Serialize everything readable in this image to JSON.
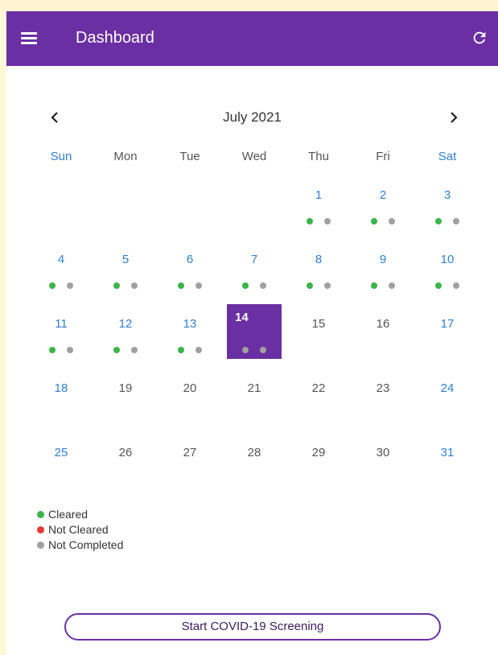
{
  "header": {
    "title": "Dashboard",
    "menu_icon": "menu-icon",
    "refresh_icon": "refresh-icon",
    "color": "#6a2fa3"
  },
  "calendar": {
    "month_label": "July 2021",
    "prev_icon": "chevron-left-icon",
    "next_icon": "chevron-right-icon",
    "weekdays": [
      "Sun",
      "Mon",
      "Tue",
      "Wed",
      "Thu",
      "Fri",
      "Sat"
    ],
    "selected_day": "14",
    "days": [
      {
        "label": "1",
        "blue": true,
        "dots": [
          "green",
          "gray"
        ]
      },
      {
        "label": "2",
        "blue": true,
        "dots": [
          "green",
          "gray"
        ]
      },
      {
        "label": "3",
        "blue": true,
        "dots": [
          "green",
          "gray"
        ]
      },
      {
        "label": "4",
        "blue": true,
        "dots": [
          "green",
          "gray"
        ]
      },
      {
        "label": "5",
        "blue": true,
        "dots": [
          "green",
          "gray"
        ]
      },
      {
        "label": "6",
        "blue": true,
        "dots": [
          "green",
          "gray"
        ]
      },
      {
        "label": "7",
        "blue": true,
        "dots": [
          "green",
          "gray"
        ]
      },
      {
        "label": "8",
        "blue": true,
        "dots": [
          "green",
          "gray"
        ]
      },
      {
        "label": "9",
        "blue": true,
        "dots": [
          "green",
          "gray"
        ]
      },
      {
        "label": "10",
        "blue": true,
        "dots": [
          "green",
          "gray"
        ]
      },
      {
        "label": "11",
        "blue": true,
        "dots": [
          "green",
          "gray"
        ]
      },
      {
        "label": "12",
        "blue": true,
        "dots": [
          "green",
          "gray"
        ]
      },
      {
        "label": "13",
        "blue": true,
        "dots": [
          "green",
          "gray"
        ]
      },
      {
        "label": "14",
        "blue": false,
        "dots": [
          "gray",
          "gray"
        ]
      },
      {
        "label": "15",
        "blue": false,
        "dots": []
      },
      {
        "label": "16",
        "blue": false,
        "dots": []
      },
      {
        "label": "17",
        "blue": true,
        "dots": []
      },
      {
        "label": "18",
        "blue": true,
        "dots": []
      },
      {
        "label": "19",
        "blue": false,
        "dots": []
      },
      {
        "label": "20",
        "blue": false,
        "dots": []
      },
      {
        "label": "21",
        "blue": false,
        "dots": []
      },
      {
        "label": "22",
        "blue": false,
        "dots": []
      },
      {
        "label": "23",
        "blue": false,
        "dots": []
      },
      {
        "label": "24",
        "blue": true,
        "dots": []
      },
      {
        "label": "25",
        "blue": true,
        "dots": []
      },
      {
        "label": "26",
        "blue": false,
        "dots": []
      },
      {
        "label": "27",
        "blue": false,
        "dots": []
      },
      {
        "label": "28",
        "blue": false,
        "dots": []
      },
      {
        "label": "29",
        "blue": false,
        "dots": []
      },
      {
        "label": "30",
        "blue": false,
        "dots": []
      },
      {
        "label": "31",
        "blue": true,
        "dots": []
      }
    ],
    "first_weekday": 4,
    "colors": {
      "green": "#3cb44a",
      "gray": "#a0a0a0",
      "red": "#e53935",
      "blue": "#2f7fd6",
      "selected": "#6a2fa3"
    }
  },
  "legend": [
    {
      "label": "Cleared",
      "color": "#3cb44a"
    },
    {
      "label": "Not Cleared",
      "color": "#e53935"
    },
    {
      "label": "Not Completed",
      "color": "#a0a0a0"
    }
  ],
  "actions": {
    "screening_button": "Start COVID-19 Screening"
  }
}
